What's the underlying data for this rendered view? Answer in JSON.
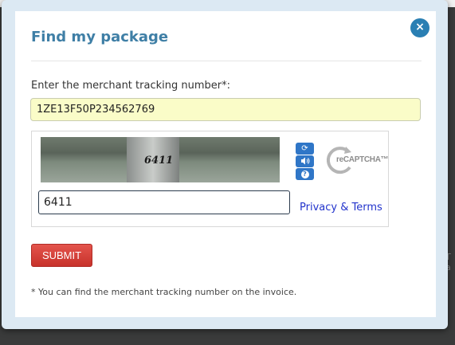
{
  "dialog": {
    "title": "Find my package",
    "close_icon": "close-icon",
    "close_label": "×"
  },
  "form": {
    "tracking_label": "Enter the merchant tracking number*:",
    "tracking_value": "1ZE13F50P234562769"
  },
  "captcha": {
    "image_text": "6411",
    "input_value": "6411",
    "refresh_icon": "refresh-icon",
    "audio_icon": "audio-icon",
    "help_icon": "help-icon",
    "refresh_glyph": "⟳",
    "audio_glyph": "🔊",
    "help_glyph": "?",
    "logo_text": "reCAPTCHA™",
    "privacy_link": "Privacy & Terms"
  },
  "submit_label": "SUBMIT",
  "footnote": "* You can find the merchant tracking number on the invoice.",
  "colors": {
    "title": "#3f7fa6",
    "close_button": "#2a7fb3",
    "submit": "#d9433c",
    "tracking_bg": "#fafcc8"
  }
}
